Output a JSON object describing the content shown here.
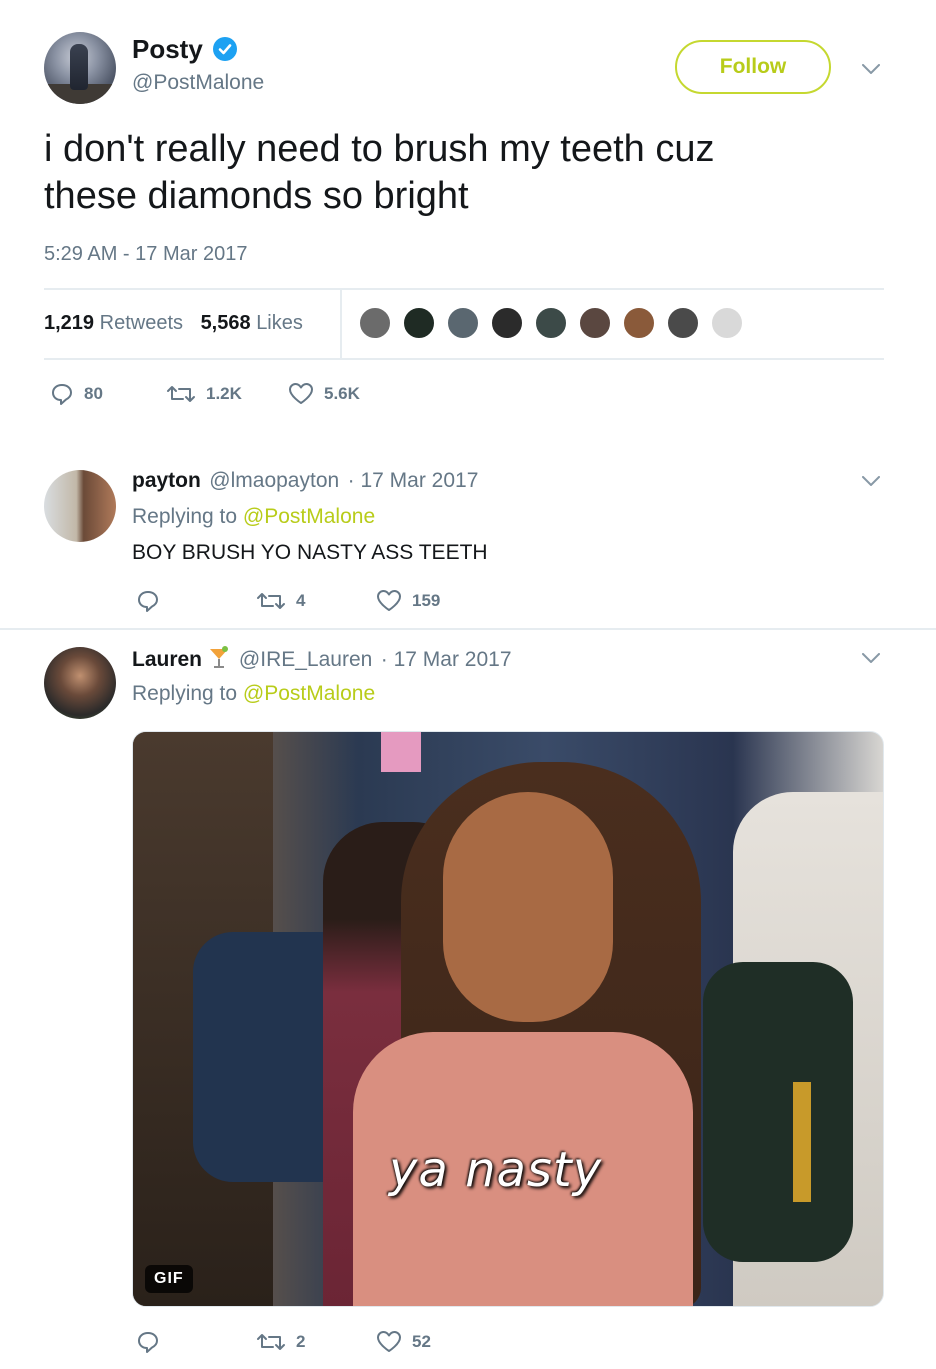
{
  "main_tweet": {
    "name": "Posty",
    "handle": "@PostMalone",
    "follow_label": "Follow",
    "text_line1": "i don't really need to brush my teeth cuz",
    "text_line2": "these diamonds so bright",
    "timestamp": "5:29 AM - 17 Mar 2017",
    "retweets_count": "1,219",
    "retweets_label": "Retweets",
    "likes_count": "5,568",
    "likes_label": "Likes",
    "actions": {
      "replies": "80",
      "retweets": "1.2K",
      "likes": "5.6K"
    }
  },
  "replies": [
    {
      "name": "payton",
      "handle": "@lmaopayton",
      "date": "· 17 Mar 2017",
      "replying_prefix": "Replying to",
      "replying_to": "@PostMalone",
      "text": "BOY BRUSH YO NASTY ASS TEETH",
      "actions": {
        "replies": "",
        "retweets": "4",
        "likes": "159"
      }
    },
    {
      "name": "Lauren",
      "handle": "@IRE_Lauren",
      "date": "· 17 Mar 2017",
      "replying_prefix": "Replying to",
      "replying_to": "@PostMalone",
      "gif_caption": "ya nasty",
      "gif_badge": "GIF",
      "actions": {
        "replies": "",
        "retweets": "2",
        "likes": "52"
      }
    }
  ],
  "colors": {
    "accent": "#c5d830",
    "verified": "#1da1f2",
    "muted": "#657786",
    "text": "#14171a"
  }
}
